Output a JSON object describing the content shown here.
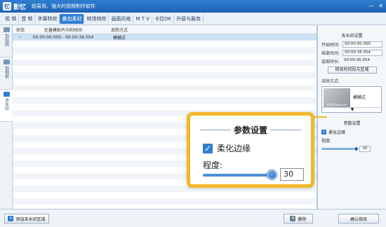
{
  "title_bar": {
    "app_name": "影忆",
    "slogan": "超易用、强大的视频制作软件",
    "logo_char": "忆",
    "min_glyph": "—",
    "close_glyph": "✕"
  },
  "menu": {
    "tabs": [
      "视 频",
      "音 频",
      "字幕特效",
      "叠加素材",
      "转场特效",
      "画面风格",
      "M T V",
      "卡拉OK",
      "升级与服务"
    ],
    "active_index": 3
  },
  "left_tabs": [
    {
      "label": "加贴图",
      "icon": "sticker-icon"
    },
    {
      "label": "加相框",
      "icon": "frame-icon"
    },
    {
      "label": "去水印",
      "icon": "watermark-icon",
      "active": true
    }
  ],
  "table": {
    "headers": [
      "状态",
      "在叠模影片中的时间",
      "去除方式"
    ],
    "rows": [
      {
        "status": "•",
        "time": "00:00:00.000 - 00:00:36.054",
        "method": "模糊式",
        "selected": true
      }
    ],
    "empty_rows": 26
  },
  "right_panel": {
    "section1_title": "去水印设置",
    "start_label": "开始时间:",
    "start_value": "00:00:00.000",
    "end_label": "结束时间:",
    "end_value": "00:00:36.054",
    "duration_label": "选取时长:",
    "duration_value": "00:00:36.054",
    "modify_button": "修改时间段与区域",
    "method_label": "去除方式:",
    "method_value": "模糊式",
    "thumb_caption": "YingYiApp.com",
    "dropdown_glyph": "▼",
    "section2_title": "参数设置",
    "soft_edge_label": "柔化边缘",
    "soft_edge_checked": true,
    "degree_label": "程度:",
    "degree_value": "30",
    "degree_level": 1.0,
    "check_glyph": "✓"
  },
  "callout": {
    "title": "参数设置",
    "soft_edge_label": "柔化边缘",
    "degree_label": "程度:",
    "degree_value": "30",
    "accent": "#f2b829",
    "check_glyph": "✓"
  },
  "bottom": {
    "add_region": "添加去水印区域",
    "delete": "删除",
    "confirm": "确认修改",
    "add_glyph": "+",
    "delete_glyph": "✕"
  }
}
